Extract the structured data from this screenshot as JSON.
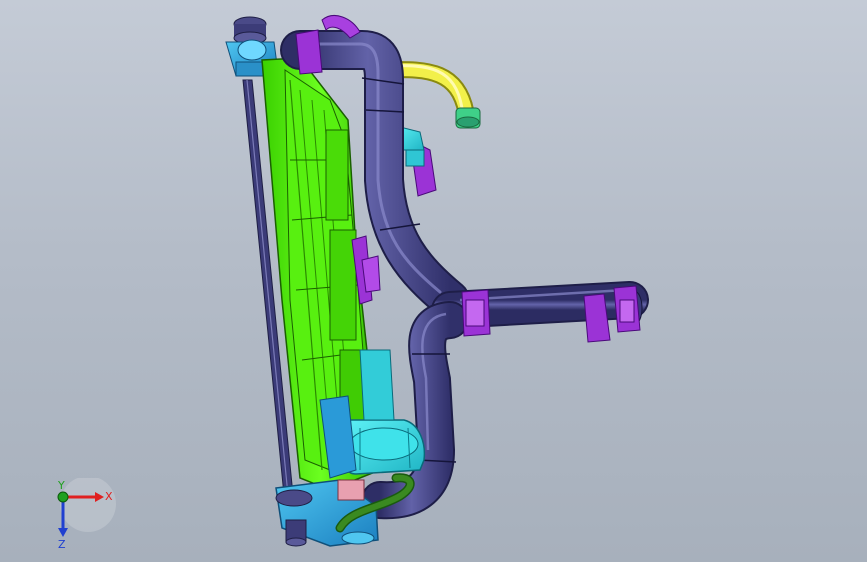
{
  "viewport": {
    "name": "3d-cad-viewport",
    "background_top": "#c4cbd6",
    "background_bottom": "#a7b0bc"
  },
  "model": {
    "parts": [
      {
        "name": "radiator-core",
        "color": "#4cf000"
      },
      {
        "name": "coolant-hose-main",
        "color": "#4b4b8a"
      },
      {
        "name": "overflow-hose",
        "color": "#f2f04a"
      },
      {
        "name": "hose-clamp",
        "color": "#9b33d6"
      },
      {
        "name": "expansion-tank",
        "color": "#35e0e6"
      },
      {
        "name": "radiator-tank-bracket",
        "color": "#2aa3e0"
      },
      {
        "name": "side-rod",
        "color": "#3b3b78"
      }
    ]
  },
  "triad": {
    "x_label": "X",
    "y_label": "Y",
    "z_label": "Z",
    "x_color": "#e02020",
    "y_color": "#20a020",
    "z_color": "#2040d0"
  }
}
